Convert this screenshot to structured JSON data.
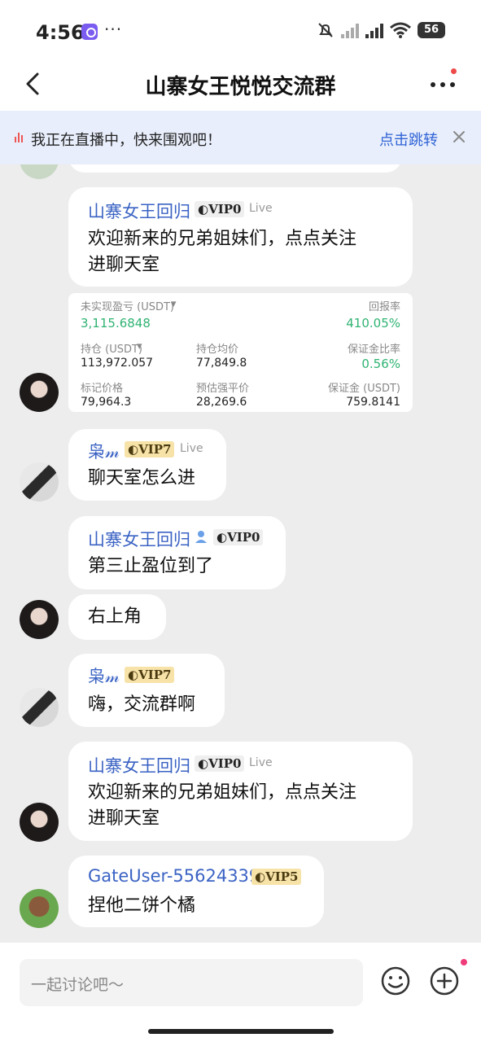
{
  "status_bar": {
    "time": "4:56",
    "dots": "···",
    "battery": "56"
  },
  "header": {
    "title": "山寨女王悦悦交流群"
  },
  "banner": {
    "text": "我正在直播中，快来围观吧！",
    "link": "点击跳转"
  },
  "messages": [
    {
      "user": "山寨女王回归",
      "vip": "VIP0",
      "tag": "Live",
      "lines": [
        "欢迎新来的兄弟姐妹们，点点关注",
        "进聊天室"
      ]
    },
    {
      "user": "枭𝓂",
      "vip": "VIP7",
      "tag": "Live",
      "lines": [
        "聊天室怎么进"
      ]
    },
    {
      "user": "山寨女王回归",
      "vip": "VIP0",
      "lines": [
        "第三止盈位到了"
      ]
    },
    {
      "lines": [
        "右上角"
      ]
    },
    {
      "user": "枭𝓂",
      "vip": "VIP7",
      "lines": [
        "嗨，交流群啊"
      ]
    },
    {
      "user": "山寨女王回归",
      "vip": "VIP0",
      "tag": "Live",
      "lines": [
        "欢迎新来的兄弟姐妹们，点点关注",
        "进聊天室"
      ]
    },
    {
      "user": "GateUser-55624339",
      "vip": "VIP5",
      "lines": [
        "捏他二饼个橘"
      ]
    }
  ],
  "position_card": {
    "pnl_label": "未实现盈亏 (USDT)",
    "pnl_value": "3,115.6848",
    "roe_label": "回报率",
    "roe_value": "410.05%",
    "size_label": "持仓 (USDT)",
    "size_value": "113,972.057",
    "entry_label": "持仓均价",
    "entry_value": "77,849.8",
    "margin_ratio_label": "保证金比率",
    "margin_ratio_value": "0.56%",
    "mark_label": "标记价格",
    "mark_value": "79,964.3",
    "liq_label": "预估强平价",
    "liq_value": "28,269.6",
    "margin_label": "保证金 (USDT)",
    "margin_value": "759.8141"
  },
  "input": {
    "placeholder": "一起讨论吧～"
  },
  "colors": {
    "link": "#2f63d6",
    "username": "#3b63c4",
    "profit": "#2fb372",
    "background": "#ededed"
  }
}
